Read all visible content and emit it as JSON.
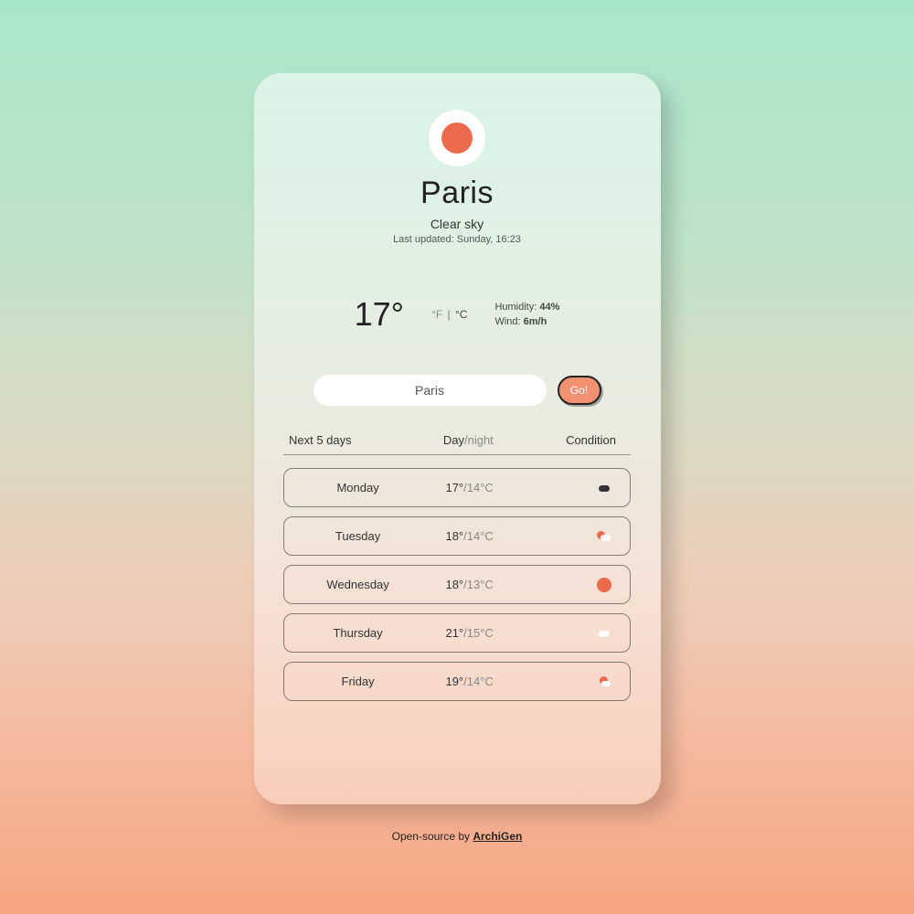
{
  "header": {
    "icon": "sun-icon",
    "city": "Paris",
    "condition": "Clear sky",
    "updated_prefix": "Last updated: ",
    "updated_value": "Sunday, 16:23"
  },
  "current": {
    "temp": "17°",
    "unit_f": "°F",
    "unit_c": "°C",
    "humidity_label": "Humidity: ",
    "humidity_value": "44%",
    "wind_label": "Wind: ",
    "wind_value": "6m/h"
  },
  "search": {
    "value": "Paris",
    "go_label": "Go!"
  },
  "table": {
    "h1": "Next 5 days",
    "h2_day": "Day",
    "h2_sep": "/",
    "h2_night": "night",
    "h3": "Condition"
  },
  "forecast": [
    {
      "day": "Monday",
      "high": "17°",
      "low": "/14°C",
      "icon": "dark"
    },
    {
      "day": "Tuesday",
      "high": "18°",
      "low": "/14°C",
      "icon": "pcloud"
    },
    {
      "day": "Wednesday",
      "high": "18°",
      "low": "/13°C",
      "icon": "sun"
    },
    {
      "day": "Thursday",
      "high": "21°",
      "low": "/15°C",
      "icon": "cloud"
    },
    {
      "day": "Friday",
      "high": "19°",
      "low": "/14°C",
      "icon": "rain"
    }
  ],
  "footer": {
    "text": "Open-source by ",
    "link_text": "ArchiGen"
  },
  "colors": {
    "accent": "#ec6b4c"
  }
}
